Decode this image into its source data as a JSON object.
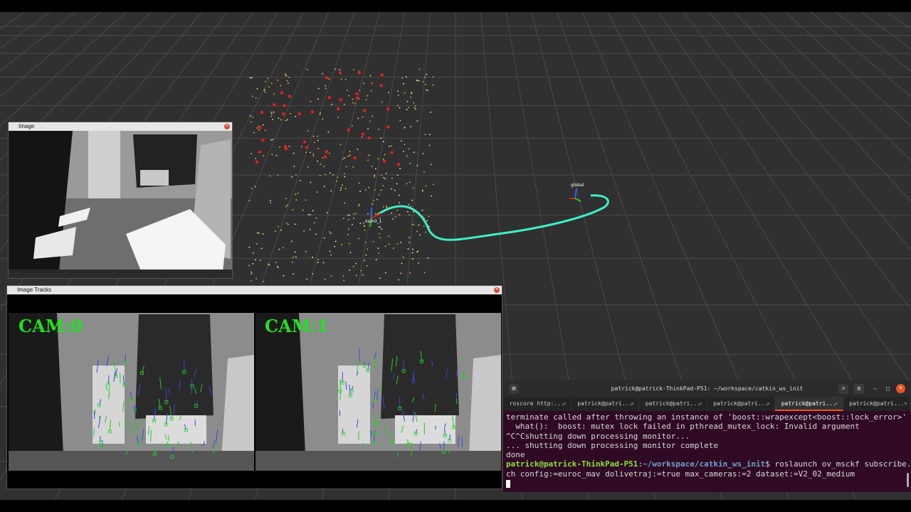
{
  "image_window": {
    "title": "Image"
  },
  "tracks_window": {
    "title": "Image Tracks",
    "cam0_label": "CAM:0",
    "cam1_label": "CAM:1"
  },
  "rviz": {
    "frame_label_a": "cam0_1",
    "frame_label_b": "global"
  },
  "terminal": {
    "title": "patrick@patrick-ThinkPad-P51: ~/workspace/catkin_ws_init",
    "tabs": [
      {
        "label": "roscore http:..."
      },
      {
        "label": "patrick@patri..."
      },
      {
        "label": "patrick@patri..."
      },
      {
        "label": "patrick@patri..."
      },
      {
        "label": "patrick@patri..."
      },
      {
        "label": "patrick@patri..."
      }
    ],
    "lines": [
      "terminate called after throwing an instance of 'boost::wrapexcept<boost::lock_error>'",
      "  what():  boost: mutex lock failed in pthread_mutex_lock: Invalid argument",
      "^C^Cshutting down processing monitor...",
      "... shutting down processing monitor complete",
      "done"
    ],
    "prompt_user": "patrick@patrick-ThinkPad-P51",
    "prompt_path": "~/workspace/catkin_ws_init",
    "command_line1": "$ roslaunch ov_msckf subscribe.laun",
    "command_line2": "ch config:=euroc_mav dolivetraj:=true max_cameras:=2 dataset:=V2_02_medium"
  },
  "colors": {
    "trajectory": "#3ef0c8",
    "feature_red": "#e02020",
    "feature_yellow": "#e8c040",
    "terminal_bg": "#300a24"
  }
}
